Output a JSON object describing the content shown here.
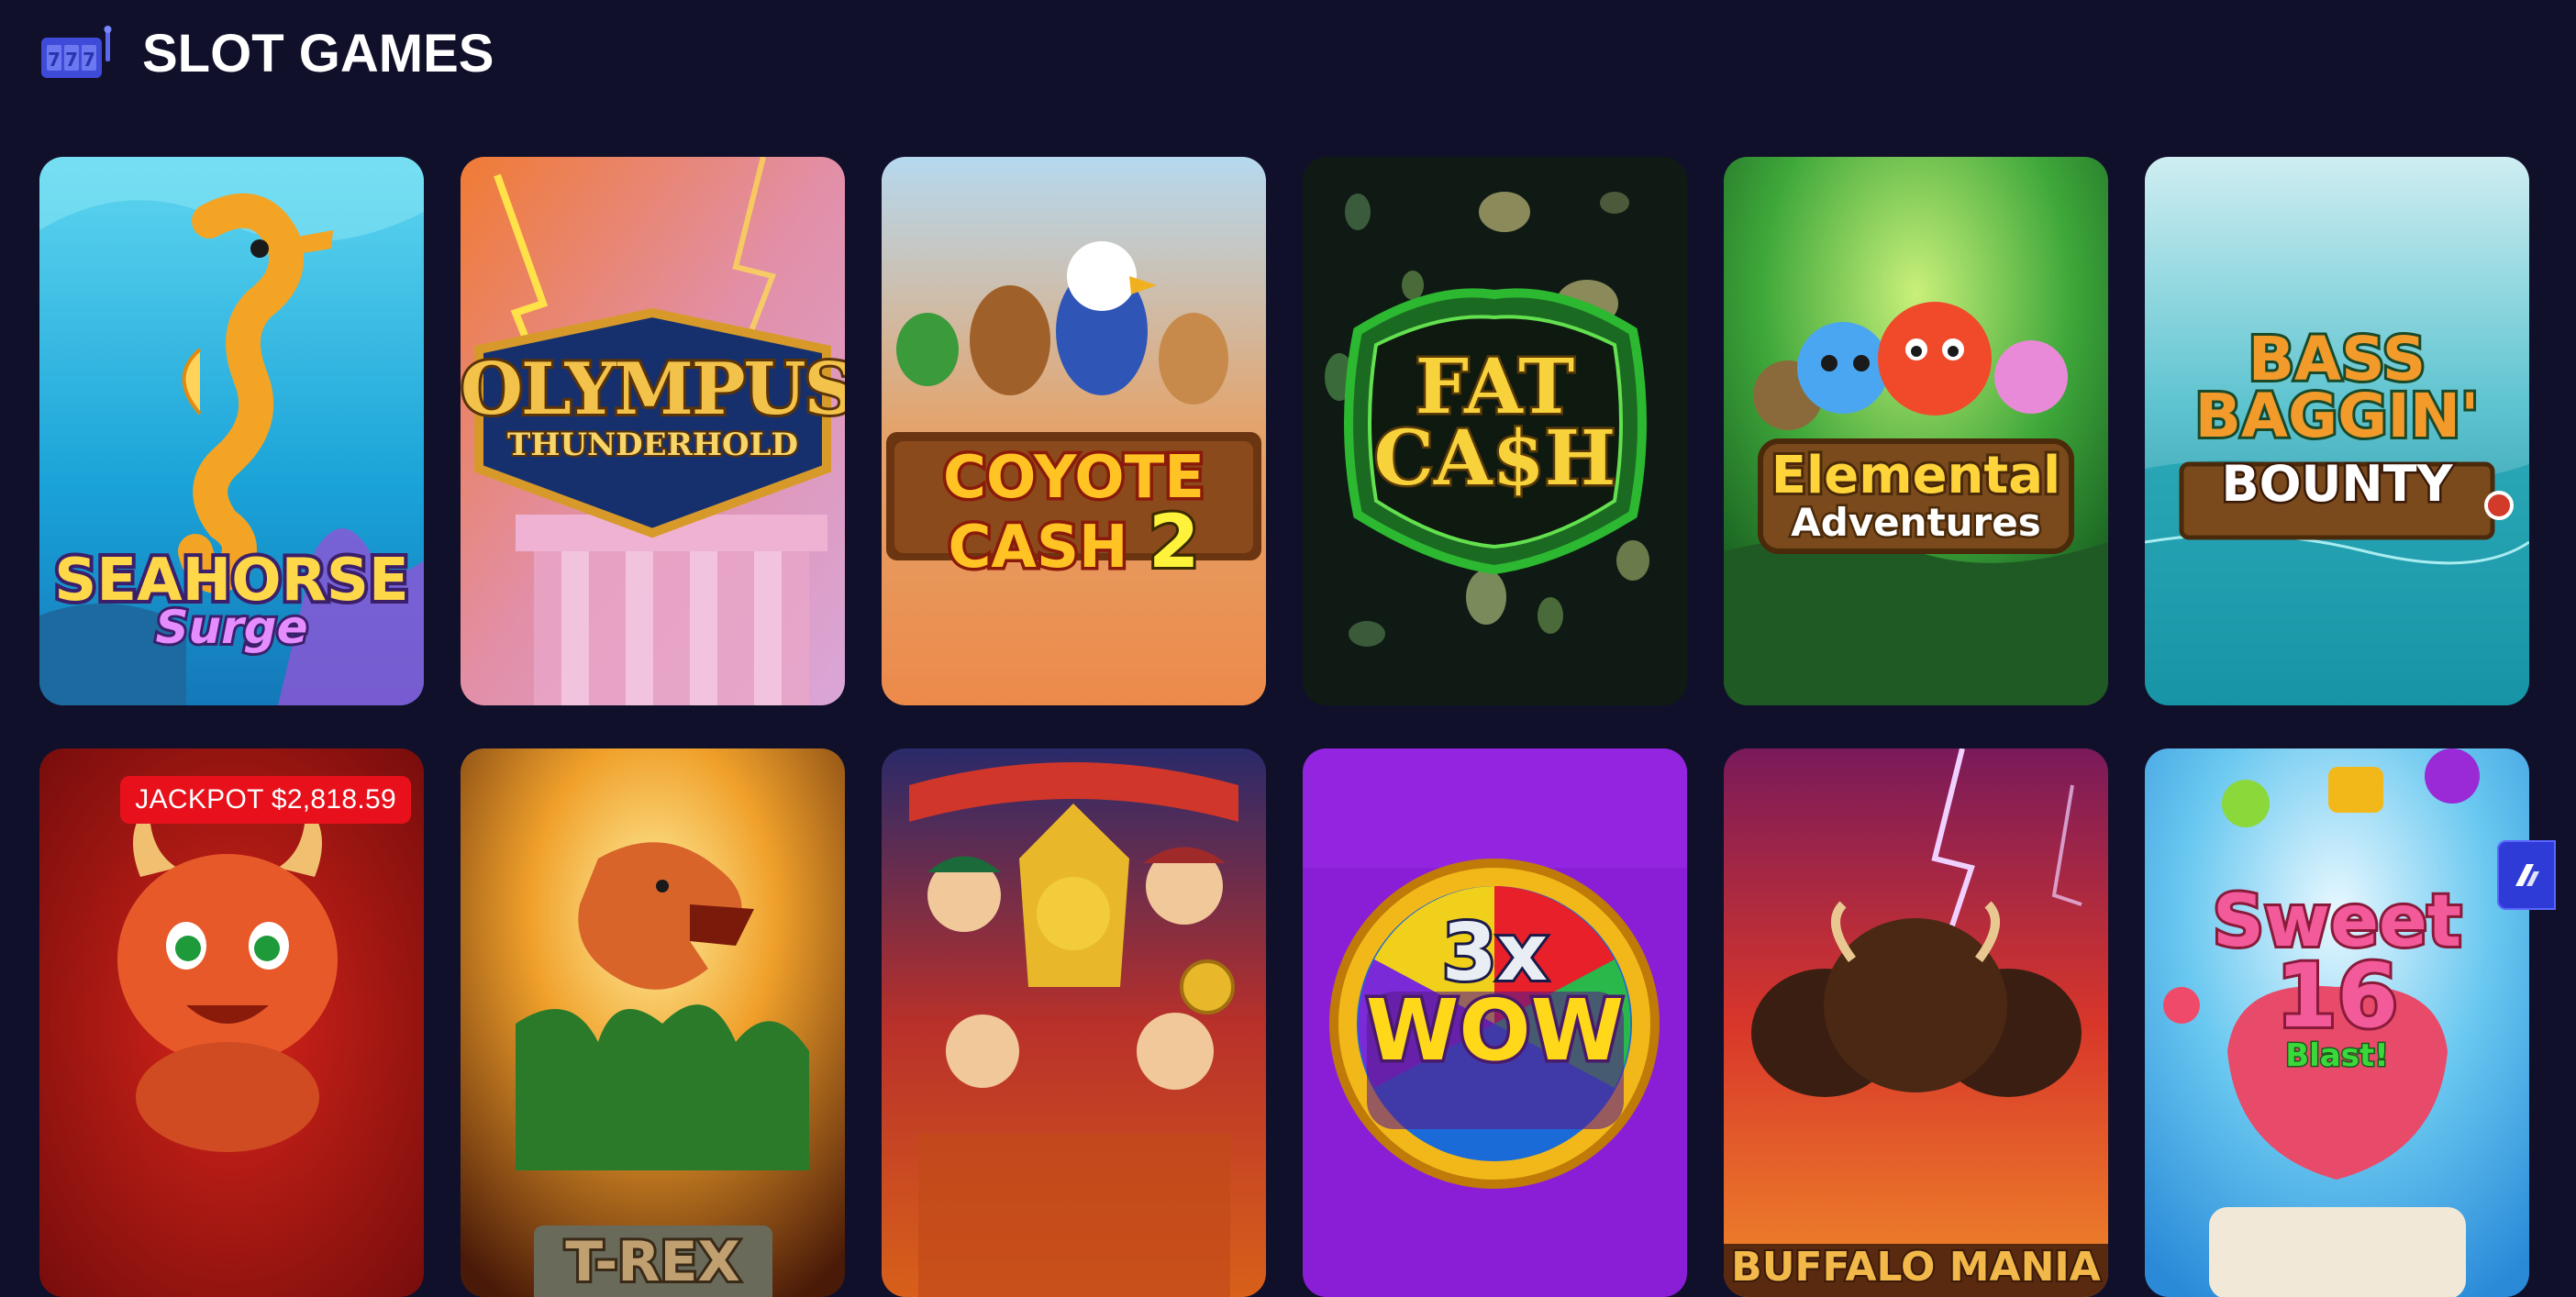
{
  "section": {
    "title": "SLOT GAMES",
    "icon": "slot-machine-icon"
  },
  "games": [
    {
      "id": "seahorse-surge",
      "title_line1": "SEAHORSE",
      "title_line2": "Surge"
    },
    {
      "id": "olympus-thunderhold",
      "title_line1": "OLYMPUS",
      "title_line2": "THUNDERHOLD"
    },
    {
      "id": "coyote-cash-2",
      "title_line1": "COYOTE",
      "title_line2": "CASH",
      "title_number": "2"
    },
    {
      "id": "fat-cash",
      "title_line1": "FAT",
      "title_line2": "CA$H"
    },
    {
      "id": "elemental-adventures",
      "title_line1": "Elemental",
      "title_line2": "Adventures"
    },
    {
      "id": "bass-baggin-bounty",
      "title_line1": "BASS",
      "title_line2": "BAGGIN'",
      "title_line3": "BOUNTY"
    },
    {
      "id": "devil-jackpot",
      "jackpot": "JACKPOT $2,818.59"
    },
    {
      "id": "t-rex",
      "title_line1": "T-REX"
    },
    {
      "id": "fortune-gods"
    },
    {
      "id": "3x-wow",
      "title_line1": "3x",
      "title_line2": "WOW"
    },
    {
      "id": "buffalo-mania",
      "title_line1": "BUFFALO MANIA"
    },
    {
      "id": "sweet-16-blast",
      "title_line1": "Sweet",
      "title_line2": "16",
      "title_line3": "Blast!"
    }
  ],
  "widget": {
    "icon": "chat-launcher-icon"
  },
  "colors": {
    "background": "#11102a",
    "jackpot_badge": "#e8111b",
    "widget": "#2e3bd6"
  }
}
